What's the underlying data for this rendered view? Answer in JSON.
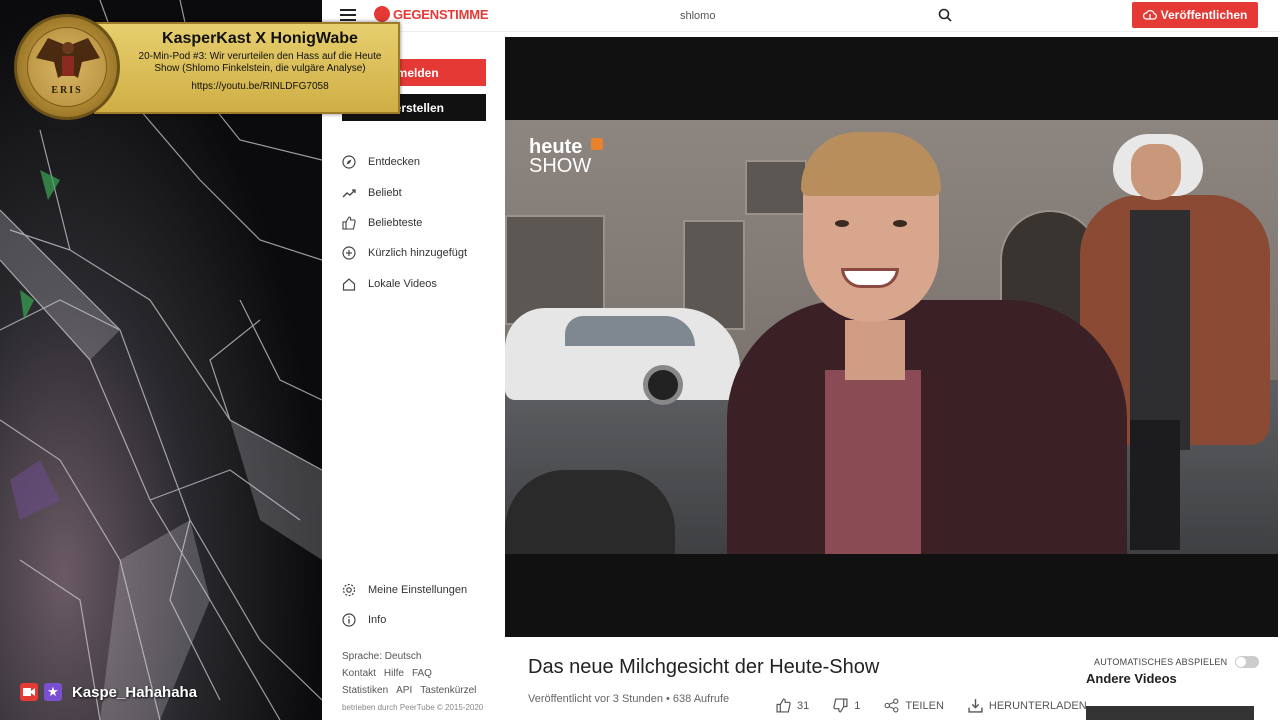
{
  "overlay": {
    "title": "KasperKast X HonigWabe",
    "subtitle": "20-Min-Pod #3: Wir verurteilen den Hass auf die Heute Show (Shlomo Finkelstein, die vulgäre Analyse)",
    "url": "https://youtu.be/RINLDFG7058",
    "medallion_text": "ERIS"
  },
  "stream": {
    "username": "Kaspe_Hahahaha"
  },
  "header": {
    "logo_text": "GEGENSTIMME",
    "search_value": "shlomo",
    "publish_label": "Veröffentlichen"
  },
  "sidebar": {
    "login_label": "nmelden",
    "create_label": "o erstellen",
    "items": [
      {
        "label": "Entdecken",
        "icon": "compass-icon"
      },
      {
        "label": "Beliebt",
        "icon": "trending-icon"
      },
      {
        "label": "Beliebteste",
        "icon": "thumbs-up-icon"
      },
      {
        "label": "Kürzlich hinzugefügt",
        "icon": "plus-circle-icon"
      },
      {
        "label": "Lokale Videos",
        "icon": "home-icon"
      }
    ],
    "bottom_items": [
      {
        "label": "Meine Einstellungen",
        "icon": "gear-icon"
      },
      {
        "label": "Info",
        "icon": "info-icon"
      }
    ],
    "footer": {
      "language": "Sprache: Deutsch",
      "links1": [
        "Kontakt",
        "Hilfe",
        "FAQ"
      ],
      "links2": [
        "Statistiken",
        "API",
        "Tastenkürzel"
      ],
      "powered": "betrieben durch PeerTube © 2015-2020"
    }
  },
  "video": {
    "channel_logo_line1": "heute",
    "channel_logo_line2": "SHOW",
    "title": "Das neue Milchgesicht der Heute-Show",
    "meta": "Veröffentlicht vor 3 Stunden • 638 Aufrufe",
    "likes": "31",
    "dislikes": "1",
    "share_label": "TEILEN",
    "download_label": "HERUNTERLADEN"
  },
  "aside": {
    "autoplay_label": "AUTOMATISCHES ABSPIELEN",
    "other_videos_label": "Andere Videos"
  },
  "colors": {
    "accent": "#e53935",
    "banner": "#d9bb55"
  }
}
